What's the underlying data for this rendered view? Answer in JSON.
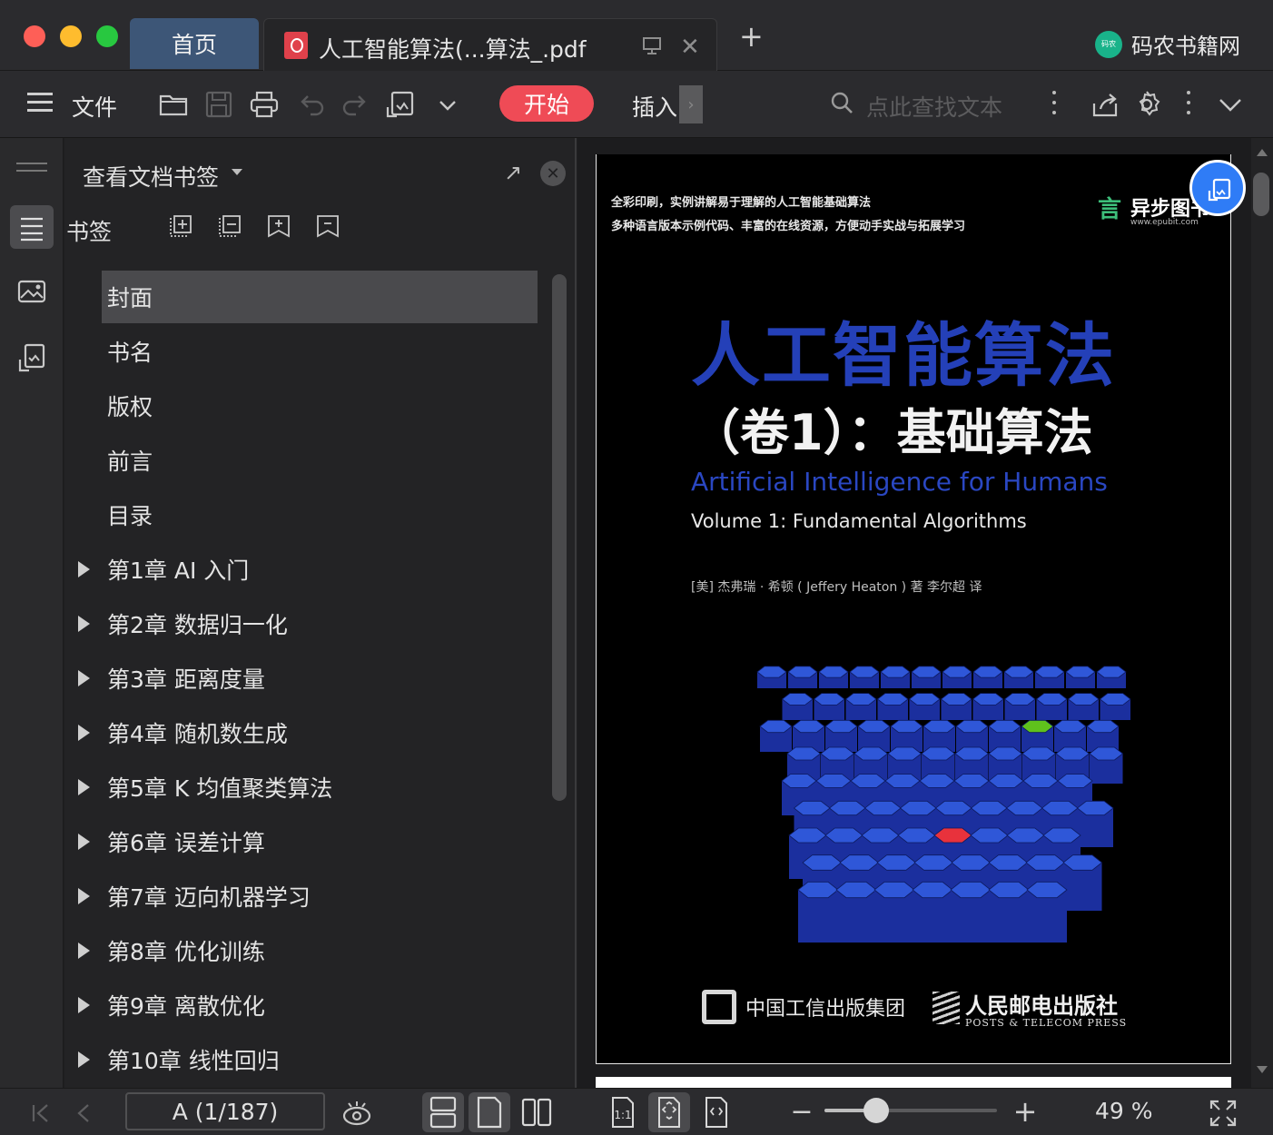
{
  "tabs": {
    "home_label": "首页",
    "doc_title": "人工智能算法(...算法_.pdf"
  },
  "brand": {
    "name": "码农书籍网",
    "logo_text": "码农"
  },
  "toolbar": {
    "file_label": "文件",
    "start_label": "开始",
    "insert_label": "插入",
    "search_placeholder": "点此查找文本"
  },
  "panel": {
    "title": "查看文档书签",
    "bookmarks_label": "书签",
    "selected_index": 0,
    "items": [
      {
        "label": "封面",
        "expandable": false
      },
      {
        "label": "书名",
        "expandable": false
      },
      {
        "label": "版权",
        "expandable": false
      },
      {
        "label": "前言",
        "expandable": false
      },
      {
        "label": "目录",
        "expandable": false
      },
      {
        "label": "第1章 AI 入门",
        "expandable": true
      },
      {
        "label": "第2章 数据归一化",
        "expandable": true
      },
      {
        "label": "第3章 距离度量",
        "expandable": true
      },
      {
        "label": "第4章 随机数生成",
        "expandable": true
      },
      {
        "label": "第5章 K 均值聚类算法",
        "expandable": true
      },
      {
        "label": "第6章 误差计算",
        "expandable": true
      },
      {
        "label": "第7章 迈向机器学习",
        "expandable": true
      },
      {
        "label": "第8章 优化训练",
        "expandable": true
      },
      {
        "label": "第9章 离散优化",
        "expandable": true
      },
      {
        "label": "第10章 线性回归",
        "expandable": true
      }
    ]
  },
  "cover": {
    "tagline1": "全彩印刷，实例讲解易于理解的人工智能基础算法",
    "tagline2": "多种语言版本示例代码、丰富的在线资源，方便动手实战与拓展学习",
    "epubit_name": "异步图书",
    "epubit_url": "www.epubit.com",
    "title_cn": "人工智能算法",
    "subtitle_cn": "（卷1）：基础算法",
    "title_en": "Artificial Intelligence for Humans",
    "subtitle_en": "Volume 1: Fundamental Algorithms",
    "author_line": "[美] 杰弗瑞 · 希顿 ( Jeffery Heaton ) 著    李尔超 译",
    "publisher1": "中国工信出版集团",
    "publisher2_cn": "人民邮电出版社",
    "publisher2_en": "POSTS & TELECOM PRESS"
  },
  "status": {
    "page_indicator": "A (1/187)",
    "zoom_text": "49 %",
    "zoom_level": 0.3
  },
  "colors": {
    "accent_red": "#ef4b56",
    "tab_active": "#3d5677",
    "title_blue": "#2440b8",
    "float_blue": "#2f7cf6"
  }
}
